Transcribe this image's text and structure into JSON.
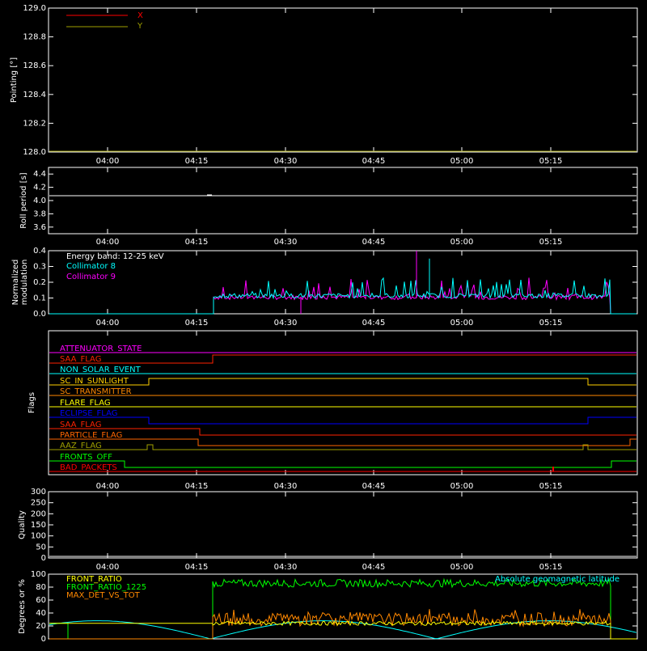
{
  "chart_data": [
    {
      "id": "pointing",
      "type": "line",
      "ylabel": "Pointing [°]",
      "ylim": [
        128.0,
        129.0
      ],
      "yticks": [
        "128.0",
        "128.2",
        "128.4",
        "128.6",
        "128.8",
        "129.0"
      ],
      "xticks": [
        "04:00",
        "04:15",
        "04:30",
        "04:45",
        "05:00",
        "05:15"
      ],
      "legend_placement": "top-left",
      "series": [
        {
          "name": "X",
          "color": "#ff0000",
          "values": []
        },
        {
          "name": "Y",
          "color": "#a0a000",
          "values": []
        }
      ]
    },
    {
      "id": "roll",
      "type": "line",
      "ylabel": "Roll period [s]",
      "ylim": [
        3.5,
        4.5
      ],
      "yticks": [
        "3.6",
        "3.8",
        "4.0",
        "4.2",
        "4.4"
      ],
      "xticks": [
        "04:00",
        "04:15",
        "04:30",
        "04:45",
        "05:00",
        "05:15"
      ],
      "series": [
        {
          "color": "#ffffff",
          "values": [
            4.08,
            4.08
          ]
        }
      ]
    },
    {
      "id": "modulation",
      "type": "line",
      "ylabel": "Normalized modulation",
      "ylim": [
        0.0,
        0.4
      ],
      "yticks": [
        "0.0",
        "0.1",
        "0.2",
        "0.3",
        "0.4"
      ],
      "xticks": [
        "04:00",
        "04:15",
        "04:30",
        "04:45",
        "05:00",
        "05:15"
      ],
      "annotation": "Energy band: 12-25 keV",
      "series": [
        {
          "name": "Collimator 8",
          "color": "#00ffff",
          "baseline": 0.1
        },
        {
          "name": "Collimator 9",
          "color": "#ff00ff",
          "baseline": 0.09
        }
      ]
    },
    {
      "id": "flags",
      "type": "line",
      "ylabel": "Flags",
      "xticks": [
        "04:00",
        "04:15",
        "04:30",
        "04:45",
        "05:00",
        "05:15"
      ],
      "flags": [
        {
          "name": "ATTENUATOR_STATE",
          "color": "#ff00ff"
        },
        {
          "name": "SAA_FLAG",
          "color": "#ff2200"
        },
        {
          "name": "NON_SOLAR_EVENT",
          "color": "#00ffff"
        },
        {
          "name": "SC_IN_SUNLIGHT",
          "color": "#ffd000"
        },
        {
          "name": "SC_TRANSMITTER",
          "color": "#ff8800"
        },
        {
          "name": "FLARE_FLAG",
          "color": "#ffff00"
        },
        {
          "name": "ECLIPSE_FLAG",
          "color": "#0000ff"
        },
        {
          "name": "SAA_FLAG",
          "color": "#ff2200"
        },
        {
          "name": "PARTICLE_FLAG",
          "color": "#ff6600"
        },
        {
          "name": "AAZ_FLAG",
          "color": "#a0a000"
        },
        {
          "name": "FRONTS_OFF",
          "color": "#00ff00"
        },
        {
          "name": "BAD_PACKETS",
          "color": "#ff0000"
        }
      ]
    },
    {
      "id": "quality",
      "type": "line",
      "ylabel": "Quality",
      "ylim": [
        0,
        300
      ],
      "yticks": [
        "0",
        "50",
        "100",
        "150",
        "200",
        "250",
        "300"
      ],
      "xticks": [
        "04:00",
        "04:15",
        "04:30",
        "04:45",
        "05:00",
        "05:15"
      ],
      "series": [
        {
          "color": "#ffffff",
          "values": []
        }
      ]
    },
    {
      "id": "ratios",
      "type": "line",
      "ylabel": "Degrees or %",
      "ylim": [
        0,
        100
      ],
      "yticks": [
        "0",
        "20",
        "40",
        "60",
        "80",
        "100"
      ],
      "series": [
        {
          "name": "FRONT_RATIO",
          "color": "#ffff00",
          "baseline": 24
        },
        {
          "name": "FRONT_RATIO_1225",
          "color": "#00ff00",
          "baseline": 86
        },
        {
          "name": "MAX_DET_VS_TOT",
          "color": "#ff8800",
          "baseline": 30
        },
        {
          "name": "Absolute geomagnetic latitude",
          "color": "#00ffff",
          "range": [
            0,
            28
          ]
        }
      ]
    }
  ]
}
